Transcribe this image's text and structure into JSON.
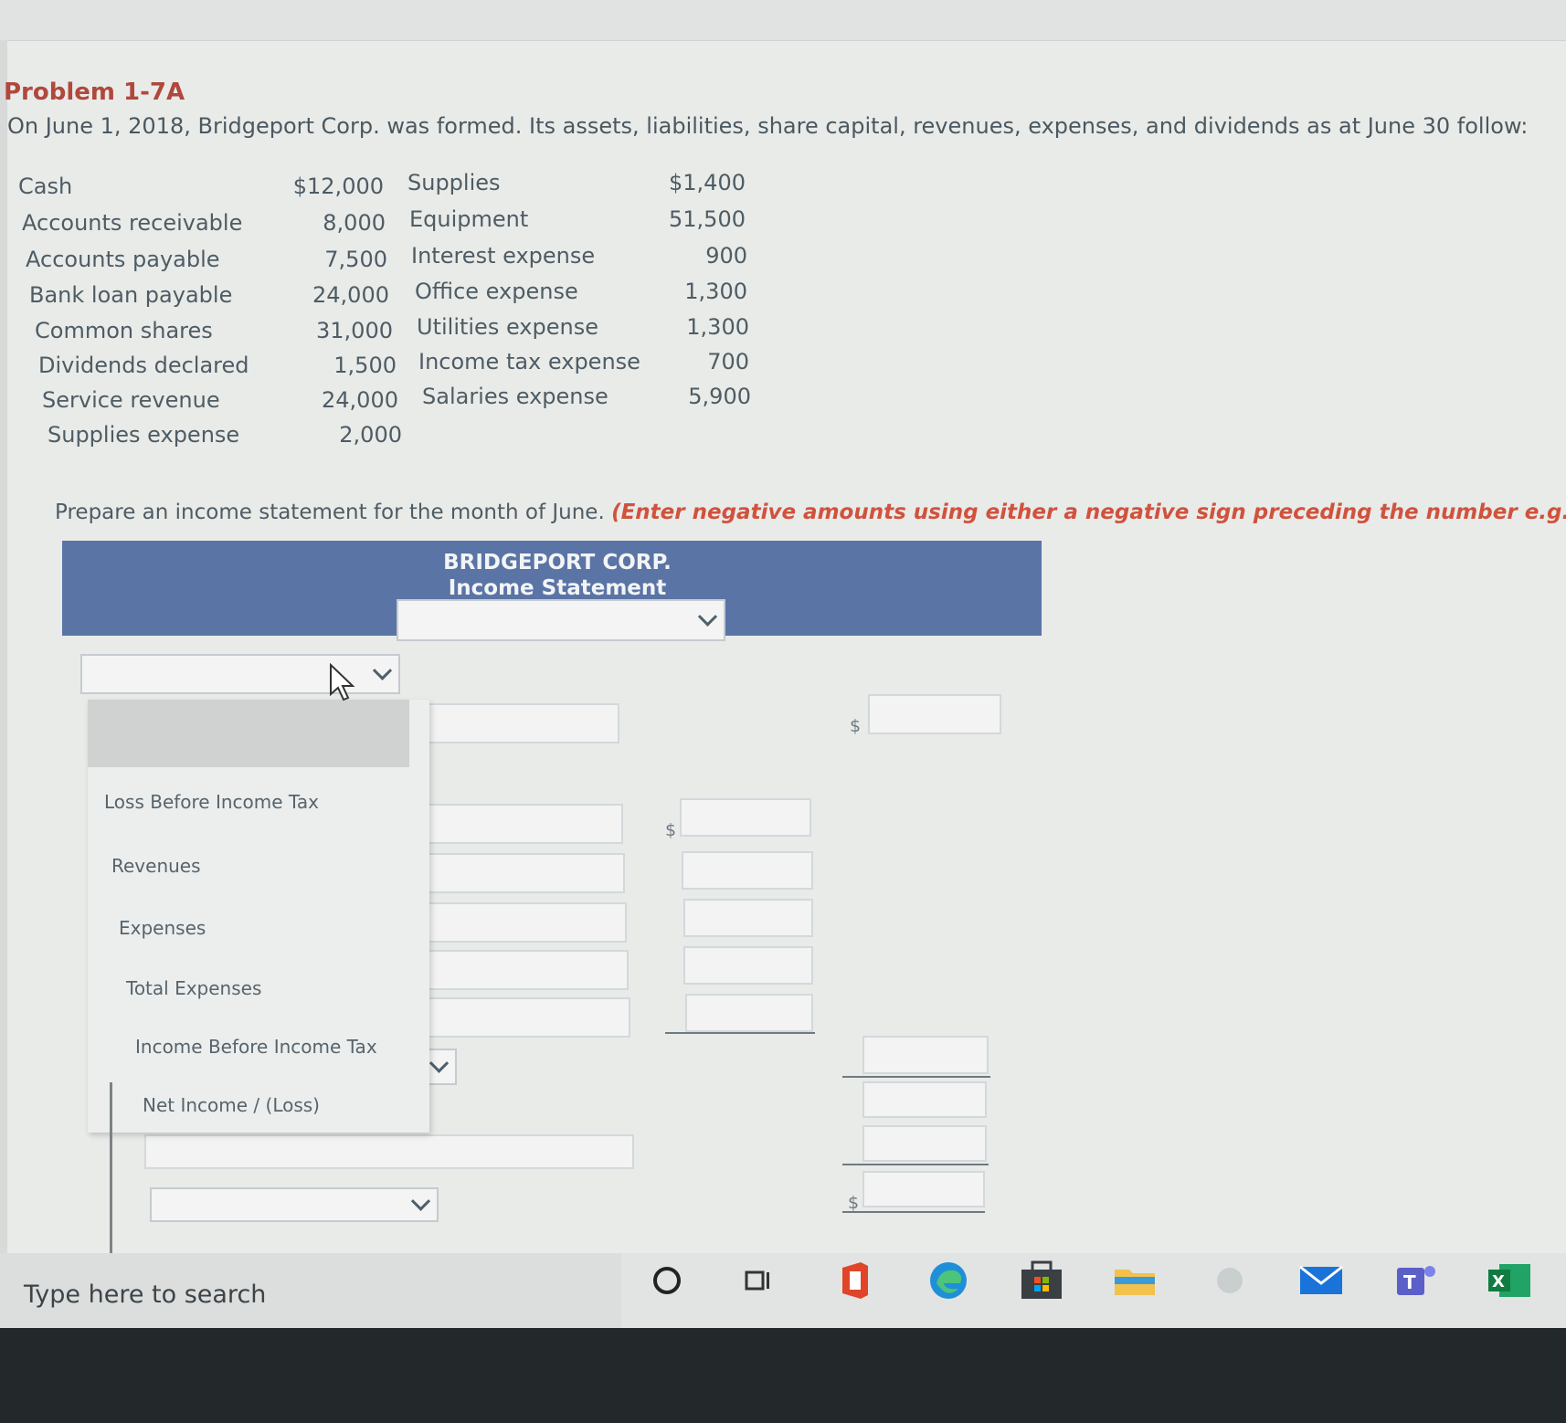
{
  "problem": {
    "title": "Problem 1-7A",
    "intro": "On June 1, 2018, Bridgeport Corp. was formed. Its assets, liabilities, share capital, revenues, expenses, and dividends as at June 30 follow:"
  },
  "accounts_left": [
    {
      "name": "Cash",
      "value": "$12,000"
    },
    {
      "name": "Accounts receivable",
      "value": "8,000"
    },
    {
      "name": "Accounts payable",
      "value": "7,500"
    },
    {
      "name": "Bank loan payable",
      "value": "24,000"
    },
    {
      "name": "Common shares",
      "value": "31,000"
    },
    {
      "name": "Dividends declared",
      "value": "1,500"
    },
    {
      "name": "Service revenue",
      "value": "24,000"
    },
    {
      "name": "Supplies expense",
      "value": "2,000"
    }
  ],
  "accounts_right": [
    {
      "name": "Supplies",
      "value": "$1,400"
    },
    {
      "name": "Equipment",
      "value": "51,500"
    },
    {
      "name": "Interest expense",
      "value": "900"
    },
    {
      "name": "Office expense",
      "value": "1,300"
    },
    {
      "name": "Utilities expense",
      "value": "1,300"
    },
    {
      "name": "Income tax expense",
      "value": "700"
    },
    {
      "name": "Salaries expense",
      "value": "5,900"
    }
  ],
  "instruction": {
    "text": "Prepare an income statement for the month of June.",
    "note": "(Enter negative amounts using either a negative sign preceding the number e.g. -45 o"
  },
  "statement": {
    "company": "BRIDGEPORT CORP.",
    "title": "Income Statement",
    "period_select": "",
    "row_select": ""
  },
  "dropdown_options": [
    "Loss Before Income Tax",
    "Revenues",
    "Expenses",
    "Total Expenses",
    "Income Before Income Tax",
    "Net Income / (Loss)"
  ],
  "currency_symbol": "$",
  "taskbar": {
    "search_placeholder": "Type here to search",
    "icons": [
      "cortana-icon",
      "task-view-icon",
      "office-icon",
      "edge-icon",
      "store-icon",
      "file-explorer-icon",
      "app-icon",
      "mail-icon",
      "teams-icon",
      "excel-icon"
    ]
  },
  "colors": {
    "header_band": "#5a74a5",
    "problem_title": "#b0483c",
    "note": "#d0523d"
  }
}
